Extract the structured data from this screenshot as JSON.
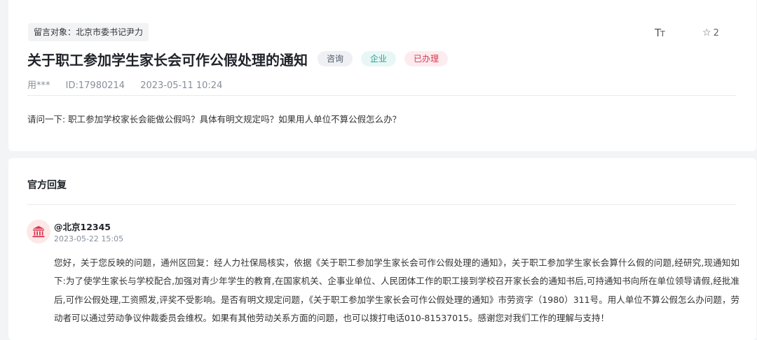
{
  "question": {
    "target": "留言对象：北京市委书记尹力",
    "toolbar": {
      "font_icon": "font-size-icon",
      "favorite_icon": "star-icon",
      "favorite_count": "2"
    },
    "title": "关于职工参加学生家长会可作公假处理的通知",
    "tags": [
      "咨询",
      "企业",
      "已办理"
    ],
    "meta": {
      "author": "用***",
      "id": "ID:17980214",
      "datetime": "2023-05-11 10:24"
    },
    "body": "请问一下: 职工参加学校家长会能做公假吗？具体有明文规定吗？如果用人单位不算公假怎么办？"
  },
  "reply": {
    "section_title": "官方回复",
    "responder": {
      "avatar_icon": "government-building-icon",
      "name": "@北京12345",
      "datetime": "2023-05-22 15:05"
    },
    "body": "您好，关于您反映的问题，通州区回复：经人力社保局核实，依据《关于职工参加学生家长会可作公假处理的通知》，关于职工参加学生家长会算什么假的问题,经研究,现通知如下:为了使学生家长与学校配合,加强对青少年学生的教育,在国家机关、企事业单位、人民团体工作的职工接到学校召开家长会的通知书后,可持通知书向所在单位领导请假,经批准后,可作公假处理,工资照发,评奖不受影响。是否有明文规定问题，《关于职工参加学生家长会可作公假处理的通知》市劳资字（1980）311号。用人单位不算公假怎么办问题，劳动者可以通过劳动争议仲裁委员会维权。如果有其他劳动关系方面的问题，也可以拨打电话010-81537015。感谢您对我们工作的理解与支持！"
  },
  "colors": {
    "tag_consult_bg": "#eef0f4",
    "tag_enterprise_bg": "#e8f7f6",
    "tag_done_bg": "#fdecef",
    "tag_done_text": "#d9364f",
    "avatar_icon": "#d9364f"
  }
}
